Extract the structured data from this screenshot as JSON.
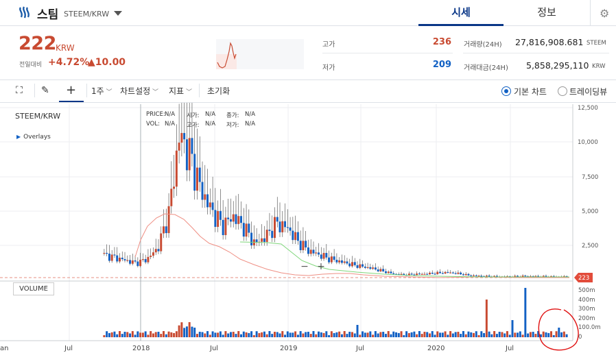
{
  "header": {
    "coin_name": "스팀",
    "pair": "STEEM/KRW",
    "tabs": [
      {
        "label": "시세"
      },
      {
        "label": "정보"
      }
    ],
    "settings_icon": "gear-icon"
  },
  "price": {
    "current": "222",
    "unit": "KRW",
    "compare_label": "전일대비",
    "change_pct": "+4.72%",
    "change_abs": "▲10.00"
  },
  "stats": {
    "high_label": "고가",
    "high": "236",
    "low_label": "저가",
    "low": "209",
    "volume_label": "거래량(24H)",
    "volume": "27,816,908.681",
    "volume_unit": "STEEM",
    "amount_label": "거래대금(24H)",
    "amount": "5,858,295,110",
    "amount_unit": "KRW"
  },
  "colors": {
    "up": "#c84a31",
    "down": "#1261c4",
    "accent": "#093687"
  },
  "toolbar": {
    "interval": "1주",
    "chart_settings": "차트설정",
    "indicators": "지표",
    "reset": "초기화",
    "basic_chart": "기본 차트",
    "tradingview": "트레이딩뷰"
  },
  "chart": {
    "symbol": "STEEM/KRW",
    "overlays_label": "Overlays",
    "info_row1": [
      "PRICE:",
      "N/A",
      "시가:",
      "N/A",
      "종가:",
      "N/A"
    ],
    "info_row2": [
      "VOL:",
      "N/A",
      "고가:",
      "N/A",
      "저가:",
      "N/A"
    ],
    "volume_button": "VOLUME",
    "zoom_out": "−",
    "zoom_in": "+",
    "current_price_tag": "223"
  },
  "chart_data": {
    "type": "candlestick",
    "x_ticks": [
      "Jan",
      "Jul",
      "2018",
      "Jul",
      "2019",
      "Jul",
      "2020",
      "Jul"
    ],
    "y_ticks": [
      "12,500",
      "10,000",
      "7,500",
      "5,000",
      "2,500"
    ],
    "vol_ticks": [
      "500m",
      "400m",
      "300m",
      "200m",
      "100.0m",
      "0"
    ],
    "ylim": [
      0,
      12500
    ],
    "close_approx": [
      1800,
      1600,
      1400,
      1200,
      1500,
      2300,
      4800,
      10500,
      9000,
      6500,
      5000,
      3900,
      4600,
      3800,
      2600,
      3100,
      4100,
      3800,
      2800,
      2100,
      1800,
      1500,
      1300,
      1100,
      950,
      800,
      600,
      400,
      350,
      400,
      420,
      480,
      520,
      430,
      300,
      260,
      240,
      220,
      230,
      260,
      240,
      230,
      225,
      223
    ],
    "ma_short_approx": [
      1700,
      3000,
      4600,
      4500,
      3800,
      3100,
      2700,
      2200,
      1700,
      1200,
      800,
      500,
      420,
      400,
      380,
      300,
      260,
      230,
      220,
      225
    ],
    "ma_long_approx": [
      2600,
      2550,
      2400,
      1500,
      900,
      600,
      500,
      420,
      350,
      280,
      250,
      230,
      225
    ]
  }
}
